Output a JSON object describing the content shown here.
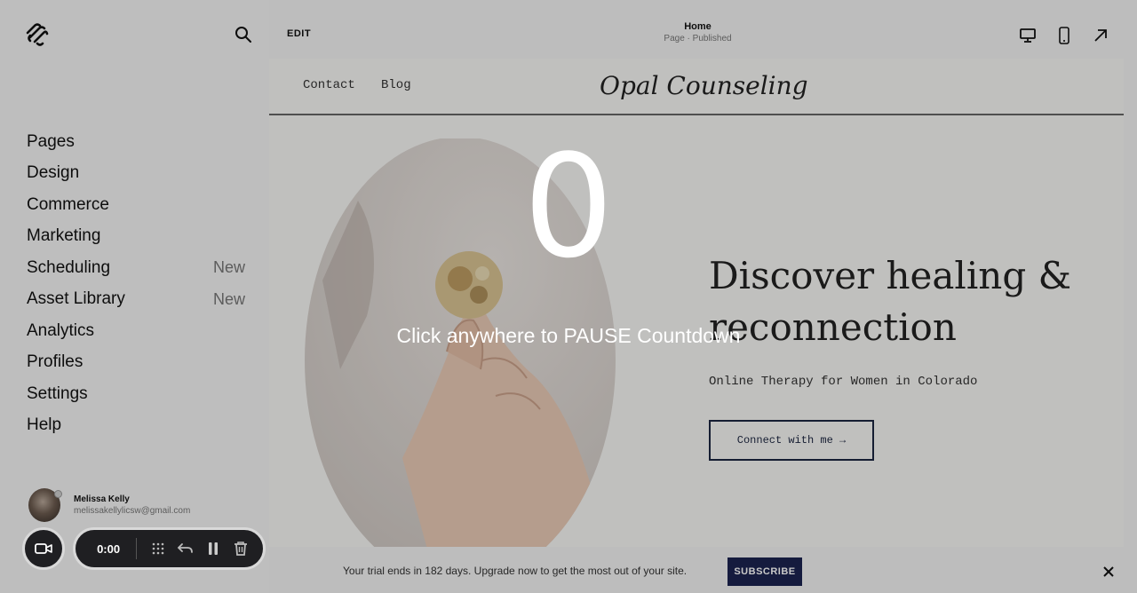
{
  "sidebar": {
    "items": [
      {
        "label": "Pages",
        "badge": ""
      },
      {
        "label": "Design",
        "badge": ""
      },
      {
        "label": "Commerce",
        "badge": ""
      },
      {
        "label": "Marketing",
        "badge": ""
      },
      {
        "label": "Scheduling",
        "badge": "New"
      },
      {
        "label": "Asset Library",
        "badge": "New"
      },
      {
        "label": "Analytics",
        "badge": ""
      },
      {
        "label": "Profiles",
        "badge": ""
      },
      {
        "label": "Settings",
        "badge": ""
      },
      {
        "label": "Help",
        "badge": ""
      }
    ],
    "user": {
      "name": "Melissa Kelly",
      "email": "melissakellylicsw@gmail.com"
    }
  },
  "recorder": {
    "time": "0:00"
  },
  "topbar": {
    "edit_label": "EDIT",
    "page_name": "Home",
    "page_status": "Page · Published"
  },
  "site": {
    "nav": [
      "Contact",
      "Blog"
    ],
    "title": "Opal Counseling",
    "headline": "Discover healing & reconnection",
    "subhead": "Online Therapy for Women in Colorado",
    "cta": "Connect with me →"
  },
  "trial": {
    "text": "Your trial ends in 182 days. Upgrade now to get the most out of your site.",
    "button": "SUBSCRIBE"
  },
  "countdown": {
    "number": "0",
    "message": "Click anywhere to PAUSE Countdown"
  },
  "colors": {
    "subscribe": "#1c2350",
    "recorder_bg": "#1f1f22",
    "cta_border": "#1c2640"
  }
}
